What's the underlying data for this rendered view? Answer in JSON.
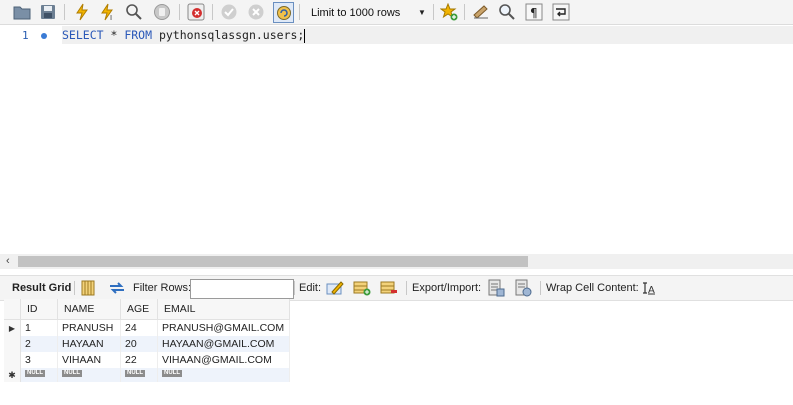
{
  "toolbar": {
    "buttons": [
      {
        "name": "open-file-icon"
      },
      {
        "name": "save-icon"
      },
      {
        "name": "execute-icon"
      },
      {
        "name": "execute-current-icon"
      },
      {
        "name": "explain-icon"
      },
      {
        "name": "stop-icon"
      },
      {
        "name": "toggle-error-icon"
      },
      {
        "name": "commit-icon"
      },
      {
        "name": "rollback-icon"
      },
      {
        "name": "autocommit-icon"
      }
    ],
    "limit_label": "Limit to 1000 rows",
    "right_buttons": [
      {
        "name": "add-snippet-icon"
      },
      {
        "name": "beautify-icon"
      },
      {
        "name": "find-icon"
      },
      {
        "name": "invisible-chars-icon"
      },
      {
        "name": "wrap-lines-icon"
      }
    ]
  },
  "editor": {
    "line_number": "1",
    "kw_select": "SELECT",
    "star": " * ",
    "kw_from": "FROM",
    "table_ref": " pythonsqlassgn.users;"
  },
  "results_bar": {
    "result_grid": "Result Grid",
    "filter_rows": "Filter Rows:",
    "filter_value": "",
    "edit": "Edit:",
    "export_import": "Export/Import:",
    "wrap_cell": "Wrap Cell Content:"
  },
  "grid": {
    "columns": [
      "ID",
      "NAME",
      "AGE",
      "EMAIL"
    ],
    "rows": [
      [
        "1",
        "PRANUSH",
        "24",
        "PRANUSH@GMAIL.COM"
      ],
      [
        "2",
        "HAYAAN",
        "20",
        "HAYAAN@GMAIL.COM"
      ],
      [
        "3",
        "VIHAAN",
        "22",
        "VIHAAN@GMAIL.COM"
      ]
    ],
    "null_label": "NULL"
  }
}
